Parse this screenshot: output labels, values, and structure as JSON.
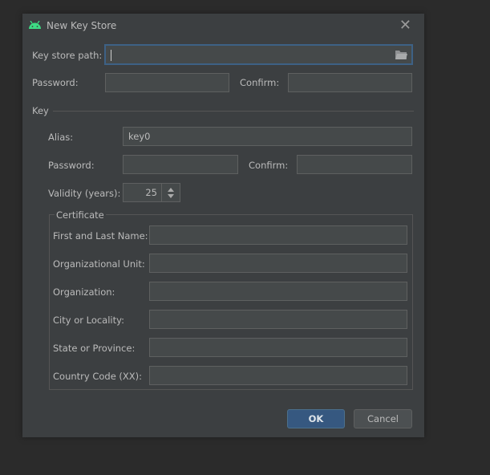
{
  "dialog": {
    "title": "New Key Store",
    "close_icon": "close-icon",
    "app_icon": "android-icon"
  },
  "keystore": {
    "path_label": "Key store path:",
    "path_value": "",
    "folder_icon": "folder-icon",
    "password_label": "Password:",
    "confirm_label": "Confirm:"
  },
  "key": {
    "section_label": "Key",
    "alias_label": "Alias:",
    "alias_value": "key0",
    "password_label": "Password:",
    "confirm_label": "Confirm:",
    "validity_label": "Validity (years):",
    "validity_value": "25"
  },
  "certificate": {
    "legend": "Certificate",
    "fields": [
      {
        "label": "First and Last Name:",
        "value": ""
      },
      {
        "label": "Organizational Unit:",
        "value": ""
      },
      {
        "label": "Organization:",
        "value": ""
      },
      {
        "label": "City or Locality:",
        "value": ""
      },
      {
        "label": "State or Province:",
        "value": ""
      },
      {
        "label": "Country Code (XX):",
        "value": ""
      }
    ]
  },
  "buttons": {
    "ok": "OK",
    "cancel": "Cancel"
  },
  "colors": {
    "accent": "#365880",
    "focus": "#3d6185",
    "android": "#3ddc84"
  }
}
